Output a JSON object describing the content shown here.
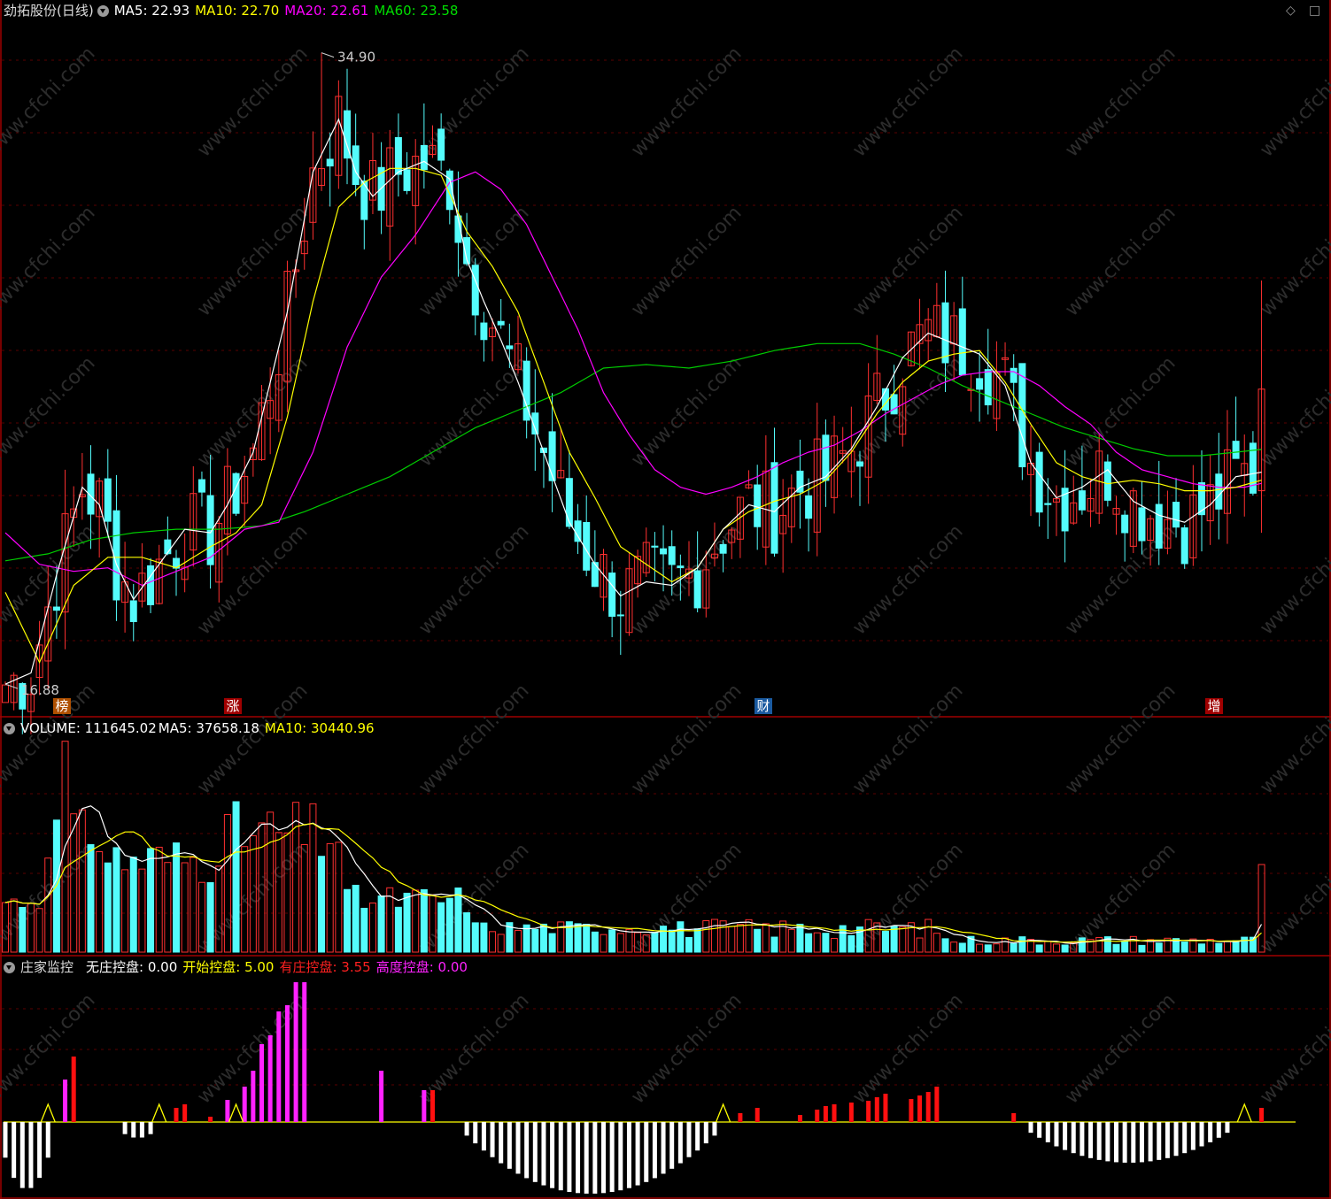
{
  "header": {
    "title": "劲拓股份(日线)",
    "ma5": "MA5: 22.93",
    "ma10": "MA10: 22.70",
    "ma20": "MA20: 22.61",
    "ma60": "MA60: 23.58",
    "icon_left": "diamond-icon",
    "icon_right": "square-icon"
  },
  "volume_header": {
    "label": "VOLUME: 111645.02",
    "ma5": "MA5: 37658.18",
    "ma10": "MA10: 30440.96"
  },
  "indicator_header": {
    "title": "庄家监控",
    "v1": "无庄控盘: 0.00",
    "v2": "开始控盘: 5.00",
    "v3": "有庄控盘: 3.55",
    "v4": "高度控盘: 0.00"
  },
  "markers": [
    "榜",
    "涨",
    "财",
    "增"
  ],
  "watermark": "www.cfchi.com",
  "colors": {
    "up": "#ff3030",
    "down": "#54fcfc",
    "ma5": "#ffffff",
    "ma10": "#ffff00",
    "ma20": "#ff00ff",
    "ma60": "#00cc00",
    "grid": "#5a0000",
    "border": "#a00000",
    "pink": "#ff22ff",
    "text_gray": "#cccccc"
  },
  "chart_data": [
    {
      "type": "candlestick",
      "price_range": [
        16.0,
        35.8
      ],
      "high_label": "34.90",
      "low_label": "16.88",
      "ma_anchors": {
        "ma5": [
          [
            0,
            16.88
          ],
          [
            3,
            17.2
          ],
          [
            6,
            20
          ],
          [
            9,
            22.5
          ],
          [
            11,
            22
          ],
          [
            13,
            20.3
          ],
          [
            15,
            19.3
          ],
          [
            18,
            20.3
          ],
          [
            21,
            21.3
          ],
          [
            24,
            21.2
          ],
          [
            26,
            22
          ],
          [
            29,
            23.5
          ],
          [
            33,
            27.5
          ],
          [
            36,
            31.5
          ],
          [
            39,
            33
          ],
          [
            41,
            31.5
          ],
          [
            43,
            30.8
          ],
          [
            46,
            31.5
          ],
          [
            49,
            31.8
          ],
          [
            52,
            31.3
          ],
          [
            54,
            29
          ],
          [
            56,
            27.8
          ],
          [
            58,
            26.7
          ],
          [
            60,
            25.5
          ],
          [
            63,
            23.5
          ],
          [
            66,
            21.5
          ],
          [
            69,
            20.3
          ],
          [
            72,
            19.4
          ],
          [
            75,
            19.8
          ],
          [
            78,
            19.7
          ],
          [
            81,
            20.2
          ],
          [
            84,
            21.3
          ],
          [
            87,
            22
          ],
          [
            90,
            21.8
          ],
          [
            93,
            22.5
          ],
          [
            96,
            22.8
          ],
          [
            99,
            23.6
          ],
          [
            102,
            24.8
          ],
          [
            105,
            26.2
          ],
          [
            108,
            26.9
          ],
          [
            111,
            26.6
          ],
          [
            114,
            26.3
          ],
          [
            117,
            25.4
          ],
          [
            120,
            23.2
          ],
          [
            123,
            22.2
          ],
          [
            126,
            22.5
          ],
          [
            129,
            23
          ],
          [
            132,
            22.1
          ],
          [
            135,
            21.7
          ],
          [
            138,
            21.5
          ],
          [
            141,
            22
          ],
          [
            144,
            22.8
          ],
          [
            147,
            22.93
          ]
        ],
        "ma10": [
          [
            0,
            19.5
          ],
          [
            4,
            17.5
          ],
          [
            8,
            19.7
          ],
          [
            12,
            20.5
          ],
          [
            16,
            20.5
          ],
          [
            20,
            20.2
          ],
          [
            24,
            20.8
          ],
          [
            27,
            21.2
          ],
          [
            30,
            22
          ],
          [
            33,
            24.5
          ],
          [
            36,
            27.8
          ],
          [
            39,
            30.5
          ],
          [
            42,
            31.2
          ],
          [
            45,
            31.6
          ],
          [
            48,
            31.6
          ],
          [
            51,
            31.4
          ],
          [
            54,
            29.8
          ],
          [
            57,
            28.8
          ],
          [
            60,
            27.5
          ],
          [
            63,
            25.5
          ],
          [
            66,
            23.5
          ],
          [
            69,
            22.2
          ],
          [
            72,
            20.8
          ],
          [
            75,
            20.3
          ],
          [
            78,
            19.8
          ],
          [
            81,
            20.2
          ],
          [
            84,
            21.3
          ],
          [
            87,
            21.8
          ],
          [
            90,
            22.1
          ],
          [
            93,
            22.3
          ],
          [
            96,
            22.7
          ],
          [
            99,
            23.5
          ],
          [
            102,
            24.6
          ],
          [
            105,
            25.5
          ],
          [
            108,
            26.1
          ],
          [
            111,
            26.3
          ],
          [
            114,
            26.4
          ],
          [
            117,
            25.5
          ],
          [
            120,
            24.3
          ],
          [
            123,
            23.2
          ],
          [
            126,
            22.8
          ],
          [
            129,
            22.6
          ],
          [
            132,
            22.7
          ],
          [
            135,
            22.6
          ],
          [
            138,
            22.4
          ],
          [
            141,
            22.4
          ],
          [
            144,
            22.5
          ],
          [
            147,
            22.7
          ]
        ],
        "ma20": [
          [
            0,
            21.2
          ],
          [
            4,
            20.3
          ],
          [
            8,
            20.1
          ],
          [
            12,
            20.2
          ],
          [
            16,
            19.7
          ],
          [
            20,
            20.1
          ],
          [
            24,
            20.5
          ],
          [
            28,
            21.3
          ],
          [
            32,
            21.5
          ],
          [
            36,
            23.5
          ],
          [
            40,
            26.5
          ],
          [
            44,
            28.5
          ],
          [
            48,
            29.7
          ],
          [
            52,
            31.2
          ],
          [
            55,
            31.5
          ],
          [
            58,
            31
          ],
          [
            61,
            30
          ],
          [
            64,
            28.5
          ],
          [
            67,
            27
          ],
          [
            70,
            25.2
          ],
          [
            73,
            24
          ],
          [
            76,
            23
          ],
          [
            79,
            22.5
          ],
          [
            82,
            22.3
          ],
          [
            85,
            22.5
          ],
          [
            88,
            22.8
          ],
          [
            91,
            23.2
          ],
          [
            94,
            23.5
          ],
          [
            97,
            23.7
          ],
          [
            100,
            24.1
          ],
          [
            103,
            24.6
          ],
          [
            106,
            25
          ],
          [
            109,
            25.4
          ],
          [
            112,
            25.7
          ],
          [
            115,
            25.8
          ],
          [
            118,
            25.8
          ],
          [
            121,
            25.4
          ],
          [
            124,
            24.8
          ],
          [
            127,
            24.3
          ],
          [
            130,
            23.5
          ],
          [
            133,
            23
          ],
          [
            136,
            22.8
          ],
          [
            139,
            22.6
          ],
          [
            142,
            22.5
          ],
          [
            145,
            22.5
          ],
          [
            147,
            22.61
          ]
        ],
        "ma60": [
          [
            0,
            20.4
          ],
          [
            5,
            20.6
          ],
          [
            10,
            21
          ],
          [
            15,
            21.2
          ],
          [
            20,
            21.3
          ],
          [
            25,
            21.3
          ],
          [
            30,
            21.4
          ],
          [
            35,
            21.8
          ],
          [
            40,
            22.3
          ],
          [
            45,
            22.8
          ],
          [
            50,
            23.5
          ],
          [
            55,
            24.2
          ],
          [
            60,
            24.7
          ],
          [
            65,
            25.2
          ],
          [
            70,
            25.9
          ],
          [
            75,
            26
          ],
          [
            80,
            25.9
          ],
          [
            85,
            26.1
          ],
          [
            90,
            26.4
          ],
          [
            95,
            26.6
          ],
          [
            100,
            26.6
          ],
          [
            104,
            26.3
          ],
          [
            108,
            25.9
          ],
          [
            112,
            25.4
          ],
          [
            116,
            25
          ],
          [
            120,
            24.6
          ],
          [
            124,
            24.2
          ],
          [
            128,
            23.9
          ],
          [
            132,
            23.6
          ],
          [
            136,
            23.4
          ],
          [
            140,
            23.4
          ],
          [
            144,
            23.5
          ],
          [
            147,
            23.58
          ]
        ]
      }
    },
    {
      "type": "bar",
      "name": "VOLUME",
      "scale_max": 128000,
      "last_value": 111645.02
    },
    {
      "type": "bar",
      "name": "庄家监控"
    }
  ]
}
